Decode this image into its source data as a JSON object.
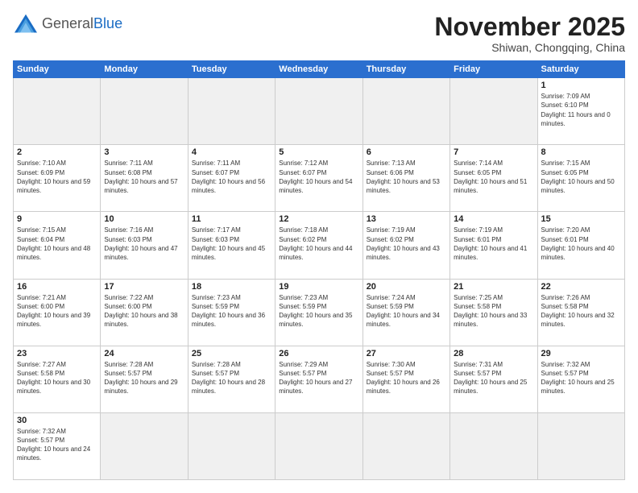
{
  "header": {
    "logo_general": "General",
    "logo_blue": "Blue",
    "month_title": "November 2025",
    "subtitle": "Shiwan, Chongqing, China"
  },
  "weekdays": [
    "Sunday",
    "Monday",
    "Tuesday",
    "Wednesday",
    "Thursday",
    "Friday",
    "Saturday"
  ],
  "weeks": [
    [
      {
        "day": "",
        "empty": true
      },
      {
        "day": "",
        "empty": true
      },
      {
        "day": "",
        "empty": true
      },
      {
        "day": "",
        "empty": true
      },
      {
        "day": "",
        "empty": true
      },
      {
        "day": "",
        "empty": true
      },
      {
        "day": "1",
        "sunrise": "7:09 AM",
        "sunset": "6:10 PM",
        "daylight": "11 hours and 0 minutes."
      }
    ],
    [
      {
        "day": "2",
        "sunrise": "7:10 AM",
        "sunset": "6:09 PM",
        "daylight": "10 hours and 59 minutes."
      },
      {
        "day": "3",
        "sunrise": "7:11 AM",
        "sunset": "6:08 PM",
        "daylight": "10 hours and 57 minutes."
      },
      {
        "day": "4",
        "sunrise": "7:11 AM",
        "sunset": "6:07 PM",
        "daylight": "10 hours and 56 minutes."
      },
      {
        "day": "5",
        "sunrise": "7:12 AM",
        "sunset": "6:07 PM",
        "daylight": "10 hours and 54 minutes."
      },
      {
        "day": "6",
        "sunrise": "7:13 AM",
        "sunset": "6:06 PM",
        "daylight": "10 hours and 53 minutes."
      },
      {
        "day": "7",
        "sunrise": "7:14 AM",
        "sunset": "6:05 PM",
        "daylight": "10 hours and 51 minutes."
      },
      {
        "day": "8",
        "sunrise": "7:15 AM",
        "sunset": "6:05 PM",
        "daylight": "10 hours and 50 minutes."
      }
    ],
    [
      {
        "day": "9",
        "sunrise": "7:15 AM",
        "sunset": "6:04 PM",
        "daylight": "10 hours and 48 minutes."
      },
      {
        "day": "10",
        "sunrise": "7:16 AM",
        "sunset": "6:03 PM",
        "daylight": "10 hours and 47 minutes."
      },
      {
        "day": "11",
        "sunrise": "7:17 AM",
        "sunset": "6:03 PM",
        "daylight": "10 hours and 45 minutes."
      },
      {
        "day": "12",
        "sunrise": "7:18 AM",
        "sunset": "6:02 PM",
        "daylight": "10 hours and 44 minutes."
      },
      {
        "day": "13",
        "sunrise": "7:19 AM",
        "sunset": "6:02 PM",
        "daylight": "10 hours and 43 minutes."
      },
      {
        "day": "14",
        "sunrise": "7:19 AM",
        "sunset": "6:01 PM",
        "daylight": "10 hours and 41 minutes."
      },
      {
        "day": "15",
        "sunrise": "7:20 AM",
        "sunset": "6:01 PM",
        "daylight": "10 hours and 40 minutes."
      }
    ],
    [
      {
        "day": "16",
        "sunrise": "7:21 AM",
        "sunset": "6:00 PM",
        "daylight": "10 hours and 39 minutes."
      },
      {
        "day": "17",
        "sunrise": "7:22 AM",
        "sunset": "6:00 PM",
        "daylight": "10 hours and 38 minutes."
      },
      {
        "day": "18",
        "sunrise": "7:23 AM",
        "sunset": "5:59 PM",
        "daylight": "10 hours and 36 minutes."
      },
      {
        "day": "19",
        "sunrise": "7:23 AM",
        "sunset": "5:59 PM",
        "daylight": "10 hours and 35 minutes."
      },
      {
        "day": "20",
        "sunrise": "7:24 AM",
        "sunset": "5:59 PM",
        "daylight": "10 hours and 34 minutes."
      },
      {
        "day": "21",
        "sunrise": "7:25 AM",
        "sunset": "5:58 PM",
        "daylight": "10 hours and 33 minutes."
      },
      {
        "day": "22",
        "sunrise": "7:26 AM",
        "sunset": "5:58 PM",
        "daylight": "10 hours and 32 minutes."
      }
    ],
    [
      {
        "day": "23",
        "sunrise": "7:27 AM",
        "sunset": "5:58 PM",
        "daylight": "10 hours and 30 minutes."
      },
      {
        "day": "24",
        "sunrise": "7:28 AM",
        "sunset": "5:57 PM",
        "daylight": "10 hours and 29 minutes."
      },
      {
        "day": "25",
        "sunrise": "7:28 AM",
        "sunset": "5:57 PM",
        "daylight": "10 hours and 28 minutes."
      },
      {
        "day": "26",
        "sunrise": "7:29 AM",
        "sunset": "5:57 PM",
        "daylight": "10 hours and 27 minutes."
      },
      {
        "day": "27",
        "sunrise": "7:30 AM",
        "sunset": "5:57 PM",
        "daylight": "10 hours and 26 minutes."
      },
      {
        "day": "28",
        "sunrise": "7:31 AM",
        "sunset": "5:57 PM",
        "daylight": "10 hours and 25 minutes."
      },
      {
        "day": "29",
        "sunrise": "7:32 AM",
        "sunset": "5:57 PM",
        "daylight": "10 hours and 25 minutes."
      }
    ],
    [
      {
        "day": "30",
        "sunrise": "7:32 AM",
        "sunset": "5:57 PM",
        "daylight": "10 hours and 24 minutes."
      },
      {
        "day": "",
        "empty": true
      },
      {
        "day": "",
        "empty": true
      },
      {
        "day": "",
        "empty": true
      },
      {
        "day": "",
        "empty": true
      },
      {
        "day": "",
        "empty": true
      },
      {
        "day": "",
        "empty": true
      }
    ]
  ]
}
